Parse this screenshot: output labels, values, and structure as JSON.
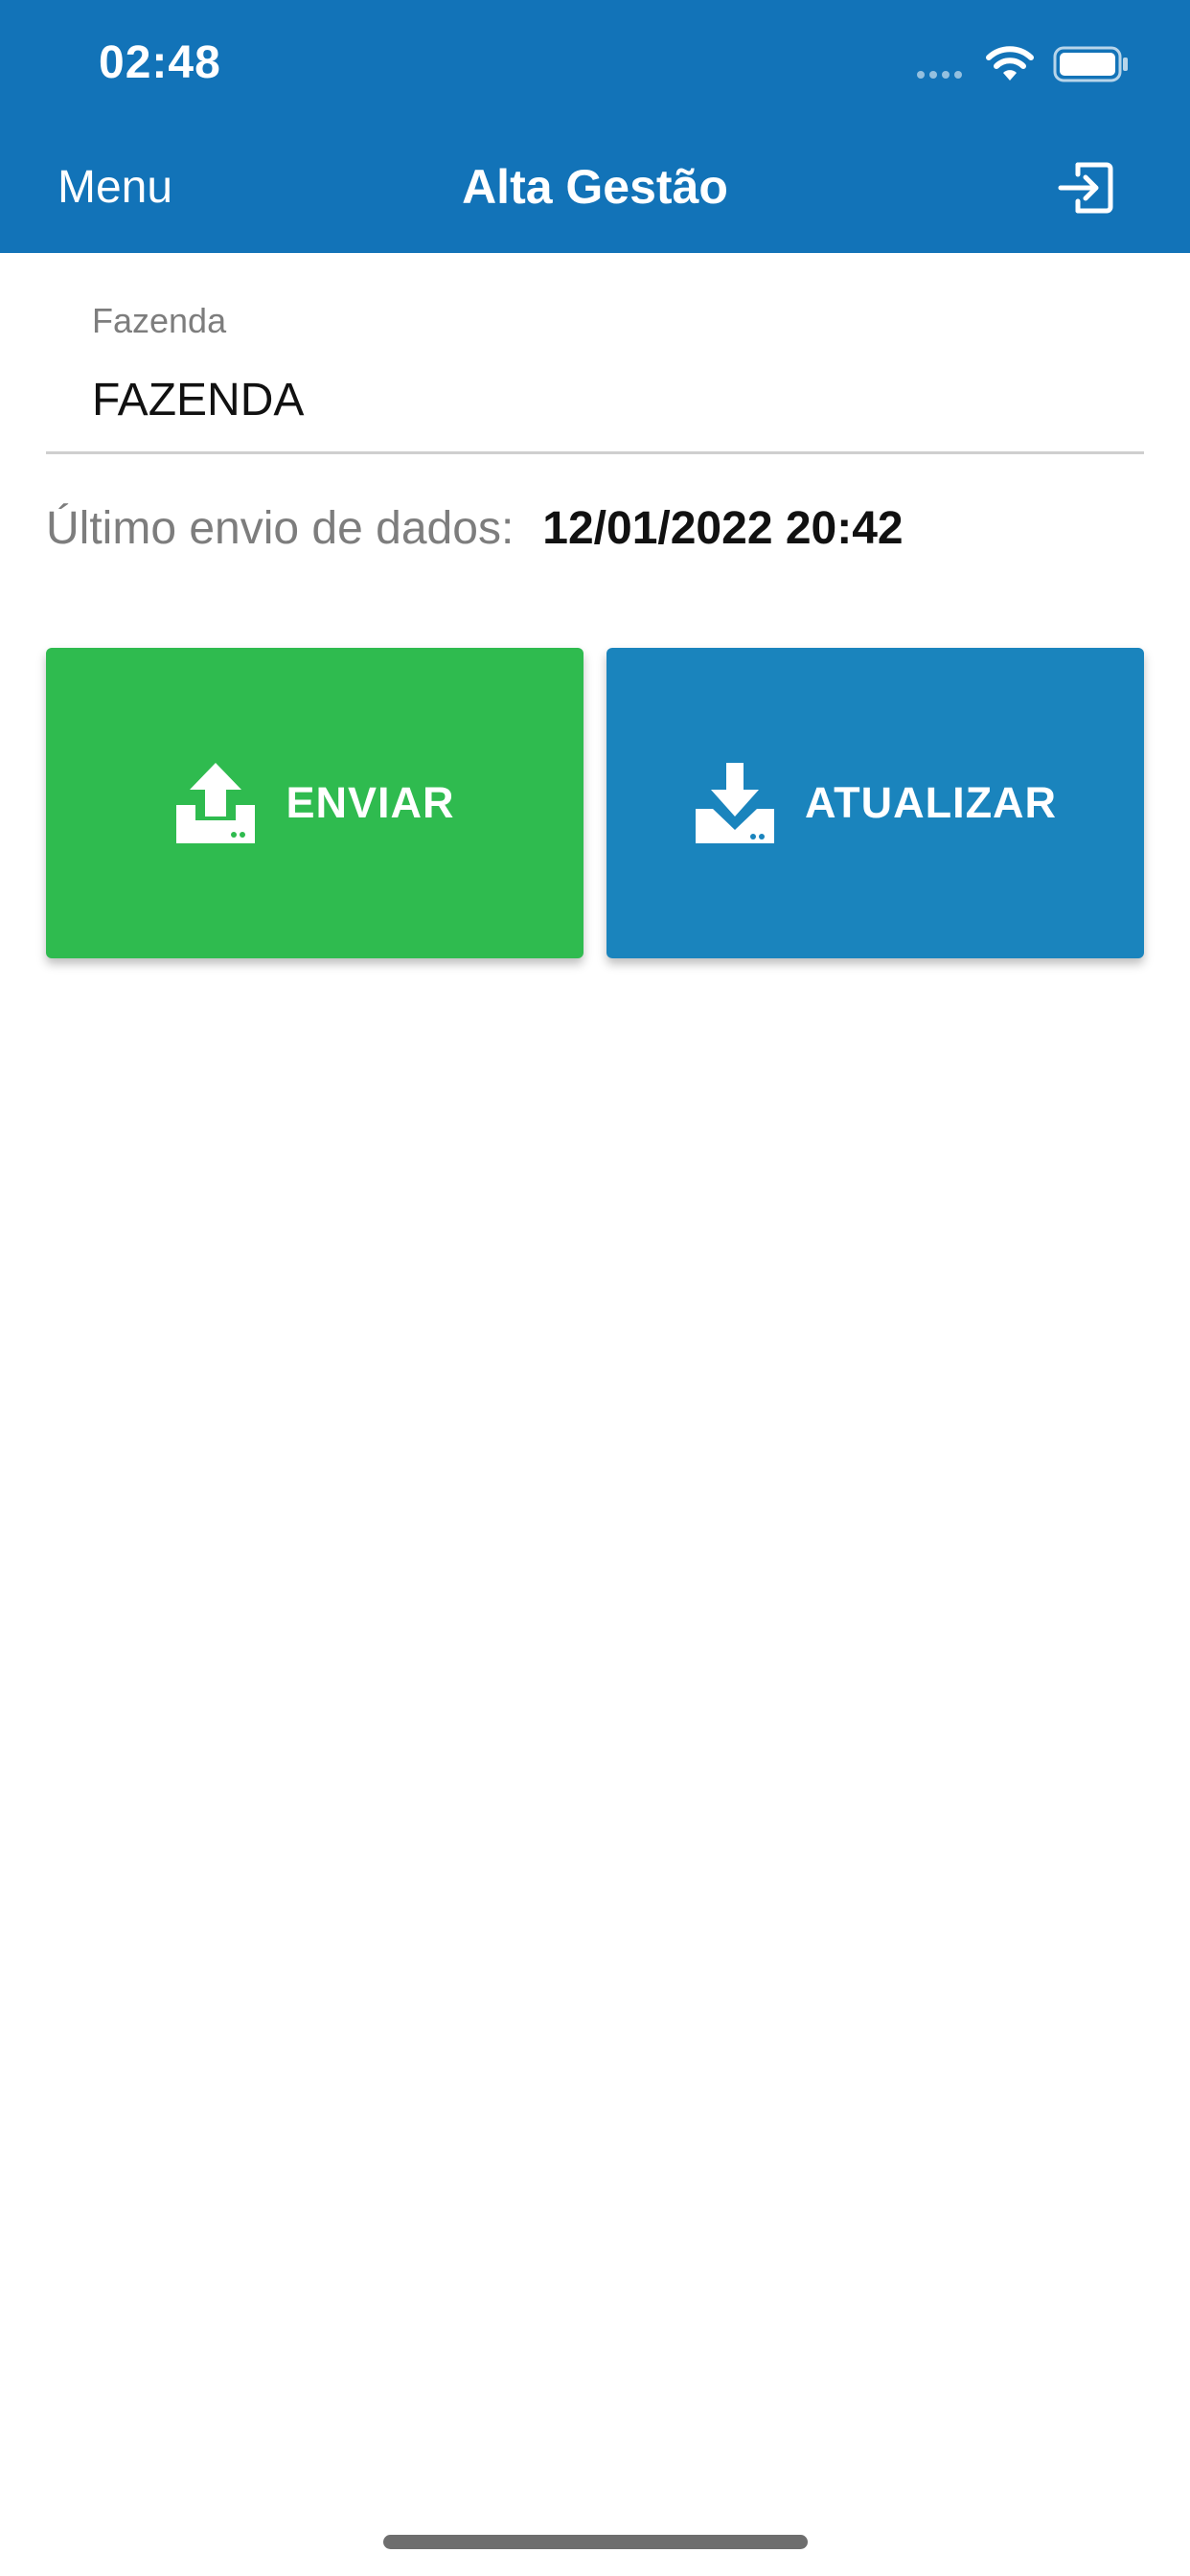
{
  "status_bar": {
    "time": "02:48",
    "icons": [
      "signal-dots-icon",
      "wifi-icon",
      "battery-icon"
    ]
  },
  "header": {
    "menu_label": "Menu",
    "title": "Alta Gestão",
    "logout_icon": "logout-icon",
    "background_color": "#1273b8"
  },
  "farm_field": {
    "label": "Fazenda",
    "value": "FAZENDA"
  },
  "last_send": {
    "label": "Último envio de dados:",
    "value": "12/01/2022 20:42"
  },
  "actions": {
    "send": {
      "label": "ENVIAR",
      "icon": "upload-icon",
      "color": "#2fbb4f"
    },
    "update": {
      "label": "ATUALIZAR",
      "icon": "download-icon",
      "color": "#1a84bd"
    }
  }
}
